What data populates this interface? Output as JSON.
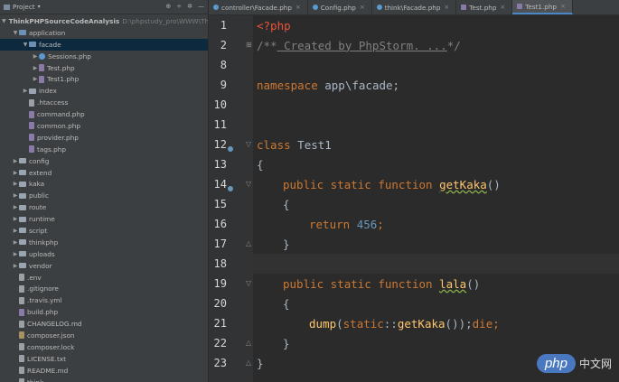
{
  "project_panel": {
    "title": "Project",
    "header_icons": [
      "target-icon",
      "collapse-icon",
      "gear-icon",
      "hide-icon"
    ]
  },
  "tree": [
    {
      "depth": 0,
      "arrow": "▼",
      "icon": "folder",
      "label": "ThinkPHPSourceCodeAnalysis",
      "path": "D:\\phpstudy_pro\\WWW\\Th"
    },
    {
      "depth": 1,
      "arrow": "▼",
      "icon": "folder-blue",
      "label": "application"
    },
    {
      "depth": 2,
      "arrow": "▼",
      "icon": "folder-blue",
      "label": "facade",
      "selected": true
    },
    {
      "depth": 3,
      "arrow": "▶",
      "icon": "class",
      "label": "Sessions.php"
    },
    {
      "depth": 3,
      "arrow": "▶",
      "icon": "php",
      "label": "Test.php"
    },
    {
      "depth": 3,
      "arrow": "▶",
      "icon": "php",
      "label": "Test1.php"
    },
    {
      "depth": 2,
      "arrow": "▶",
      "icon": "folder",
      "label": "index"
    },
    {
      "depth": 2,
      "arrow": "",
      "icon": "txt",
      "label": ".htaccess"
    },
    {
      "depth": 2,
      "arrow": "",
      "icon": "php",
      "label": "command.php"
    },
    {
      "depth": 2,
      "arrow": "",
      "icon": "php",
      "label": "common.php"
    },
    {
      "depth": 2,
      "arrow": "",
      "icon": "php",
      "label": "provider.php"
    },
    {
      "depth": 2,
      "arrow": "",
      "icon": "php",
      "label": "tags.php"
    },
    {
      "depth": 1,
      "arrow": "▶",
      "icon": "folder",
      "label": "config"
    },
    {
      "depth": 1,
      "arrow": "▶",
      "icon": "folder",
      "label": "extend"
    },
    {
      "depth": 1,
      "arrow": "▶",
      "icon": "folder",
      "label": "kaka"
    },
    {
      "depth": 1,
      "arrow": "▶",
      "icon": "folder",
      "label": "public"
    },
    {
      "depth": 1,
      "arrow": "▶",
      "icon": "folder",
      "label": "route"
    },
    {
      "depth": 1,
      "arrow": "▶",
      "icon": "folder",
      "label": "runtime"
    },
    {
      "depth": 1,
      "arrow": "▶",
      "icon": "folder",
      "label": "script"
    },
    {
      "depth": 1,
      "arrow": "▶",
      "icon": "folder",
      "label": "thinkphp"
    },
    {
      "depth": 1,
      "arrow": "▶",
      "icon": "folder",
      "label": "uploads"
    },
    {
      "depth": 1,
      "arrow": "▶",
      "icon": "folder",
      "label": "vendor"
    },
    {
      "depth": 1,
      "arrow": "",
      "icon": "txt",
      "label": ".env"
    },
    {
      "depth": 1,
      "arrow": "",
      "icon": "txt",
      "label": ".gitignore"
    },
    {
      "depth": 1,
      "arrow": "",
      "icon": "txt",
      "label": ".travis.yml"
    },
    {
      "depth": 1,
      "arrow": "",
      "icon": "php",
      "label": "build.php"
    },
    {
      "depth": 1,
      "arrow": "",
      "icon": "txt",
      "label": "CHANGELOG.md"
    },
    {
      "depth": 1,
      "arrow": "",
      "icon": "json",
      "label": "composer.json"
    },
    {
      "depth": 1,
      "arrow": "",
      "icon": "txt",
      "label": "composer.lock"
    },
    {
      "depth": 1,
      "arrow": "",
      "icon": "txt",
      "label": "LICENSE.txt"
    },
    {
      "depth": 1,
      "arrow": "",
      "icon": "txt",
      "label": "README.md"
    },
    {
      "depth": 1,
      "arrow": "",
      "icon": "txt",
      "label": "think"
    }
  ],
  "tabs": [
    {
      "label": "controller\\Facade.php",
      "icon": "class"
    },
    {
      "label": "Config.php",
      "icon": "class"
    },
    {
      "label": "think\\Facade.php",
      "icon": "class"
    },
    {
      "label": "Test.php",
      "icon": "php"
    },
    {
      "label": "Test1.php",
      "icon": "php",
      "active": true
    }
  ],
  "line_numbers": [
    "1",
    "2",
    "8",
    "9",
    "10",
    "11",
    "12",
    "13",
    "14",
    "15",
    "16",
    "17",
    "18",
    "19",
    "20",
    "21",
    "22",
    "23"
  ],
  "code_text": {
    "l1": "<?php",
    "l2_open": "/**",
    "l2_body": " Created by PhpStorm. ...",
    "l2_close": "*/",
    "l9_kw": "namespace",
    "l9_ns": " app\\facade;",
    "l12_kw": "class",
    "l12_name": " Test1",
    "open_brace": "{",
    "close_brace": "}",
    "pub": "public static function ",
    "getKaka": "getKaka",
    "parens": "()",
    "return_kw": "return ",
    "num": "456",
    "semi": ";",
    "lala": "lala",
    "dump_fn": "dump",
    "dump_args_a": "(",
    "static_kw": "static",
    "dump_args_b": "::",
    "dump_args_c": "getKaka",
    "dump_args_d": "());",
    "die_kw": "die",
    "die_semi": ";"
  },
  "watermark": {
    "logo": "php",
    "text": "中文网"
  },
  "colors": {
    "keyword": "#cc7832",
    "function": "#ffc66d",
    "number": "#6897bb",
    "comment": "#808080",
    "php_tag": "#e8533b"
  }
}
